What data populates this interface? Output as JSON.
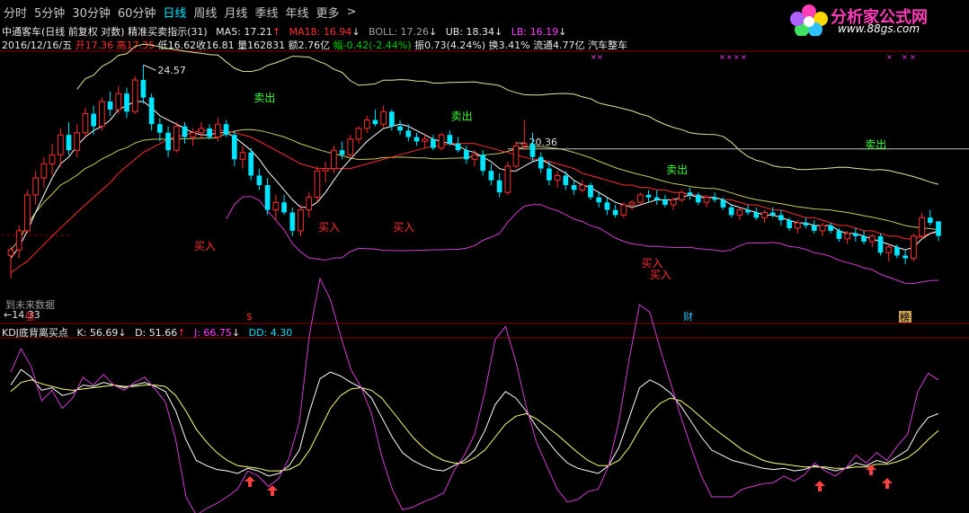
{
  "toolbar": {
    "periods": [
      "分时",
      "5分钟",
      "30分钟",
      "60分钟",
      "日线",
      "周线",
      "月线",
      "季线",
      "年线",
      "更多"
    ],
    "active": "日线",
    "chevron": ">"
  },
  "logo": {
    "name": "分析家公式网",
    "url": "www.88gs.com"
  },
  "header": {
    "stock": "中通客车(日线 前复权 对数)",
    "indicator": "精准买卖指示(31)",
    "ma5": "MA5: 17.21",
    "ma5_arrow": "↑",
    "ma18": "MA18: 16.94",
    "ma18_arrow": "↓",
    "boll": "BOLL: 17.26",
    "boll_arrow": "↓",
    "ub": "UB: 18.34",
    "ub_arrow": "↓",
    "lb": "LB: 16.19",
    "lb_arrow": "↓"
  },
  "quote": {
    "date": "2016/12/16/五",
    "open": "开17.36",
    "high": "高17.35",
    "low": "低16.62",
    "close": "收16.81",
    "volume": "量162831",
    "amount": "额2.76亿",
    "change": "幅-0.42(-2.44%)",
    "amplitude": "振0.73(4.24%)",
    "turnover": "换3.41%",
    "float": "流通4.77亿",
    "sector": "汽车整车"
  },
  "annotations": {
    "high_label": "24.57",
    "low_label": "14.33",
    "hline_label": "20.36",
    "hline_prefix": "— ",
    "sell": "卖出",
    "buy": "买入",
    "no_data": "到未来数据",
    "markers": [
      "张",
      "$",
      "财",
      "榜"
    ]
  },
  "kdj": {
    "name": "KDJ底背离买点",
    "k": "K: 56.69",
    "k_arrow": "↓",
    "d": "D: 51.66",
    "d_arrow": "↑",
    "j": "J: 66.75",
    "j_arrow": "↓",
    "dd": "DD: 4.30"
  },
  "colors": {
    "up": "#ff3030",
    "down": "#00e5ff",
    "ma5": "#ffffff",
    "ma18": "#ff3030",
    "boll": "#c8c864",
    "upper": "#e6e6a0",
    "lower": "#d040d0",
    "k": "#ffffff",
    "d": "#ffff80",
    "j": "#d040d0"
  },
  "chart_data": [
    {
      "type": "candlestick",
      "title": "中通客车(日线 前复权 对数)",
      "ylim": [
        14.0,
        25.2
      ],
      "candles": [
        [
          16.1,
          16.4,
          15.3,
          16.3
        ],
        [
          16.3,
          17.2,
          16.0,
          17.0
        ],
        [
          17.0,
          18.6,
          16.9,
          18.4
        ],
        [
          18.4,
          19.4,
          18.0,
          19.1
        ],
        [
          19.1,
          20.0,
          18.7,
          19.7
        ],
        [
          19.7,
          20.6,
          19.2,
          20.1
        ],
        [
          20.1,
          21.3,
          19.6,
          21.0
        ],
        [
          21.0,
          21.6,
          20.1,
          20.3
        ],
        [
          20.3,
          21.5,
          20.0,
          21.1
        ],
        [
          21.1,
          22.3,
          20.9,
          22.0
        ],
        [
          22.0,
          22.4,
          21.0,
          21.4
        ],
        [
          21.4,
          22.8,
          21.2,
          22.6
        ],
        [
          22.6,
          23.1,
          21.9,
          22.2
        ],
        [
          22.2,
          23.4,
          22.0,
          23.0
        ],
        [
          23.0,
          23.3,
          21.8,
          22.1
        ],
        [
          22.1,
          23.9,
          22.0,
          23.7
        ],
        [
          23.7,
          24.5,
          22.5,
          22.8
        ],
        [
          22.8,
          23.0,
          21.2,
          21.5
        ],
        [
          21.5,
          21.8,
          20.7,
          21.1
        ],
        [
          21.1,
          21.4,
          20.0,
          20.3
        ],
        [
          20.3,
          21.6,
          20.2,
          21.4
        ],
        [
          21.4,
          21.6,
          20.6,
          20.9
        ],
        [
          20.9,
          21.3,
          20.5,
          21.1
        ],
        [
          21.1,
          21.6,
          20.8,
          21.3
        ],
        [
          21.3,
          21.5,
          20.8,
          20.9
        ],
        [
          20.9,
          21.8,
          20.7,
          21.5
        ],
        [
          21.5,
          21.7,
          20.9,
          21.0
        ],
        [
          21.0,
          21.2,
          19.6,
          19.9
        ],
        [
          19.9,
          20.5,
          19.5,
          20.2
        ],
        [
          20.2,
          20.4,
          19.0,
          19.2
        ],
        [
          19.2,
          19.5,
          18.6,
          18.8
        ],
        [
          18.8,
          19.1,
          17.6,
          17.8
        ],
        [
          17.8,
          18.4,
          17.4,
          18.1
        ],
        [
          18.1,
          18.4,
          17.6,
          17.7
        ],
        [
          17.7,
          17.9,
          16.8,
          17.0
        ],
        [
          17.0,
          18.0,
          16.8,
          17.8
        ],
        [
          17.8,
          18.5,
          17.5,
          18.3
        ],
        [
          18.3,
          19.6,
          18.1,
          19.4
        ],
        [
          19.4,
          19.8,
          18.9,
          19.5
        ],
        [
          19.5,
          20.5,
          19.3,
          20.3
        ],
        [
          20.3,
          20.7,
          19.9,
          20.1
        ],
        [
          20.1,
          21.0,
          20.0,
          20.8
        ],
        [
          20.8,
          21.4,
          20.6,
          21.3
        ],
        [
          21.3,
          21.9,
          21.1,
          21.7
        ],
        [
          21.7,
          22.2,
          21.4,
          21.5
        ],
        [
          21.5,
          22.4,
          21.3,
          22.1
        ],
        [
          22.1,
          22.2,
          21.2,
          21.4
        ],
        [
          21.4,
          21.7,
          21.0,
          21.2
        ],
        [
          21.2,
          21.5,
          20.7,
          20.9
        ],
        [
          20.9,
          21.1,
          20.5,
          20.7
        ],
        [
          20.7,
          21.0,
          20.4,
          20.8
        ],
        [
          20.8,
          21.0,
          20.3,
          20.4
        ],
        [
          20.4,
          21.1,
          20.3,
          21.0
        ],
        [
          21.0,
          21.2,
          20.5,
          20.6
        ],
        [
          20.6,
          20.9,
          20.2,
          20.3
        ],
        [
          20.3,
          20.5,
          19.7,
          19.9
        ],
        [
          19.9,
          20.3,
          19.6,
          20.1
        ],
        [
          20.1,
          20.3,
          19.2,
          19.4
        ],
        [
          19.4,
          19.7,
          18.8,
          19.0
        ],
        [
          19.0,
          19.3,
          18.3,
          18.5
        ],
        [
          18.5,
          19.8,
          18.4,
          19.6
        ],
        [
          19.6,
          20.7,
          19.5,
          20.5
        ],
        [
          20.5,
          21.7,
          20.3,
          20.6
        ],
        [
          20.6,
          21.1,
          19.8,
          20.0
        ],
        [
          20.0,
          20.2,
          19.3,
          19.5
        ],
        [
          19.5,
          19.8,
          18.8,
          19.0
        ],
        [
          19.0,
          19.4,
          18.7,
          19.2
        ],
        [
          19.2,
          19.4,
          18.6,
          18.8
        ],
        [
          18.8,
          19.0,
          18.4,
          18.6
        ],
        [
          18.6,
          19.0,
          18.5,
          18.8
        ],
        [
          18.8,
          18.9,
          18.2,
          18.3
        ],
        [
          18.3,
          18.5,
          17.9,
          18.1
        ],
        [
          18.1,
          18.3,
          17.6,
          17.8
        ],
        [
          17.8,
          18.0,
          17.5,
          17.6
        ],
        [
          17.6,
          18.1,
          17.5,
          18.0
        ],
        [
          18.0,
          18.2,
          17.8,
          18.1
        ],
        [
          18.1,
          18.5,
          18.0,
          18.4
        ],
        [
          18.4,
          18.6,
          18.1,
          18.3
        ],
        [
          18.3,
          18.6,
          18.0,
          18.2
        ],
        [
          18.2,
          18.4,
          17.9,
          18.0
        ],
        [
          18.0,
          18.3,
          17.8,
          18.2
        ],
        [
          18.2,
          18.6,
          18.1,
          18.5
        ],
        [
          18.5,
          18.7,
          18.2,
          18.4
        ],
        [
          18.4,
          18.5,
          18.0,
          18.1
        ],
        [
          18.1,
          18.4,
          17.9,
          18.3
        ],
        [
          18.3,
          18.5,
          18.1,
          18.2
        ],
        [
          18.2,
          18.3,
          17.8,
          17.9
        ],
        [
          17.9,
          18.0,
          17.5,
          17.6
        ],
        [
          17.6,
          17.9,
          17.4,
          17.8
        ],
        [
          17.8,
          18.0,
          17.6,
          17.7
        ],
        [
          17.7,
          17.9,
          17.4,
          17.5
        ],
        [
          17.5,
          17.8,
          17.3,
          17.7
        ],
        [
          17.7,
          17.9,
          17.5,
          17.6
        ],
        [
          17.6,
          17.8,
          17.2,
          17.4
        ],
        [
          17.4,
          17.5,
          17.0,
          17.1
        ],
        [
          17.1,
          17.4,
          16.9,
          17.3
        ],
        [
          17.3,
          17.5,
          17.1,
          17.2
        ],
        [
          17.2,
          17.4,
          16.9,
          17.0
        ],
        [
          17.0,
          17.3,
          16.8,
          17.2
        ],
        [
          17.2,
          17.3,
          16.9,
          17.0
        ],
        [
          17.0,
          17.1,
          16.6,
          16.7
        ],
        [
          16.7,
          17.0,
          16.5,
          16.9
        ],
        [
          16.9,
          17.1,
          16.6,
          16.8
        ],
        [
          16.8,
          17.0,
          16.5,
          16.6
        ],
        [
          16.6,
          16.9,
          16.4,
          16.8
        ],
        [
          16.8,
          16.9,
          16.1,
          16.2
        ],
        [
          16.2,
          16.5,
          15.9,
          16.4
        ],
        [
          16.4,
          16.5,
          16.0,
          16.1
        ],
        [
          16.1,
          16.3,
          15.8,
          16.0
        ],
        [
          16.0,
          16.9,
          15.9,
          16.8
        ],
        [
          16.8,
          17.7,
          16.7,
          17.5
        ],
        [
          17.5,
          17.8,
          17.2,
          17.3
        ],
        [
          17.36,
          17.35,
          16.62,
          16.81
        ]
      ],
      "ma5": [
        16.0,
        16.4,
        17.0,
        17.7,
        18.4,
        19.1,
        19.7,
        20.0,
        20.5,
        20.9,
        21.2,
        21.4,
        21.7,
        22.2,
        22.4,
        22.6,
        22.6,
        22.3,
        21.9,
        21.7,
        21.5,
        21.3,
        21.1,
        21.0,
        21.0,
        21.1,
        21.1,
        20.9,
        20.6,
        20.3,
        19.9,
        19.4,
        19.0,
        18.6,
        18.2,
        17.9,
        17.9,
        18.1,
        18.5,
        19.0,
        19.5,
        19.9,
        20.3,
        20.7,
        21.0,
        21.3,
        21.4,
        21.5,
        21.4,
        21.2,
        21.0,
        20.8,
        20.7,
        20.6,
        20.5,
        20.3,
        20.2,
        20.0,
        19.8,
        19.5,
        19.4,
        19.4,
        19.6,
        19.8,
        19.9,
        19.7,
        19.5,
        19.3,
        19.0,
        18.8,
        18.7,
        18.5,
        18.3,
        18.1,
        18.0,
        17.9,
        18.0,
        18.1,
        18.2,
        18.2,
        18.2,
        18.3,
        18.4,
        18.3,
        18.3,
        18.3,
        18.2,
        18.0,
        17.9,
        17.8,
        17.7,
        17.6,
        17.6,
        17.5,
        17.4,
        17.3,
        17.3,
        17.2,
        17.2,
        17.2,
        17.0,
        16.9,
        16.9,
        16.8,
        16.7,
        16.6,
        16.5,
        16.4,
        16.3,
        16.4,
        16.7,
        16.9,
        17.0
      ],
      "ma18": [
        15.5,
        15.7,
        15.9,
        16.2,
        16.5,
        16.8,
        17.1,
        17.4,
        17.7,
        18.0,
        18.3,
        18.6,
        18.9,
        19.3,
        19.6,
        19.9,
        20.2,
        20.4,
        20.6,
        20.8,
        20.9,
        21.0,
        21.1,
        21.2,
        21.2,
        21.2,
        21.2,
        21.1,
        21.0,
        20.9,
        20.7,
        20.5,
        20.3,
        20.1,
        19.9,
        19.7,
        19.6,
        19.5,
        19.5,
        19.5,
        19.5,
        19.5,
        19.6,
        19.7,
        19.8,
        19.9,
        20.0,
        20.1,
        20.2,
        20.3,
        20.4,
        20.5,
        20.5,
        20.6,
        20.6,
        20.6,
        20.6,
        20.5,
        20.4,
        20.3,
        20.2,
        20.1,
        20.0,
        19.9,
        19.9,
        19.8,
        19.7,
        19.6,
        19.5,
        19.3,
        19.2,
        19.1,
        19.0,
        18.9,
        18.8,
        18.8,
        18.7,
        18.7,
        18.6,
        18.6,
        18.5,
        18.5,
        18.4,
        18.4,
        18.3,
        18.3,
        18.2,
        18.2,
        18.1,
        18.0,
        18.0,
        17.9,
        17.8,
        17.8,
        17.7,
        17.6,
        17.5,
        17.5,
        17.4,
        17.3,
        17.2,
        17.2,
        17.1,
        17.0,
        17.0,
        16.9,
        16.8,
        16.8,
        16.7,
        16.7,
        16.8,
        16.9,
        16.94
      ]
    },
    {
      "type": "line",
      "title": "KDJ底背离买点",
      "ylim": [
        -15,
        115
      ],
      "series": [
        {
          "name": "K",
          "values": [
            80,
            92,
            86,
            76,
            78,
            72,
            74,
            80,
            79,
            82,
            80,
            78,
            80,
            82,
            79,
            75,
            60,
            38,
            22,
            18,
            15,
            14,
            12,
            16,
            14,
            10,
            12,
            18,
            30,
            60,
            85,
            90,
            87,
            82,
            78,
            70,
            55,
            40,
            28,
            22,
            18,
            15,
            14,
            18,
            22,
            30,
            45,
            65,
            75,
            70,
            60,
            48,
            38,
            28,
            20,
            16,
            14,
            12,
            18,
            32,
            55,
            78,
            84,
            80,
            74,
            64,
            52,
            40,
            30,
            26,
            22,
            20,
            18,
            16,
            15,
            16,
            14,
            15,
            18,
            16,
            14,
            16,
            20,
            18,
            22,
            20,
            25,
            30,
            45,
            55,
            58
          ]
        },
        {
          "name": "D",
          "values": [
            75,
            82,
            84,
            81,
            79,
            77,
            76,
            77,
            78,
            79,
            80,
            79,
            79,
            80,
            80,
            79,
            72,
            60,
            46,
            36,
            28,
            22,
            18,
            17,
            16,
            14,
            14,
            15,
            19,
            30,
            46,
            62,
            72,
            77,
            78,
            76,
            70,
            60,
            50,
            40,
            32,
            26,
            22,
            20,
            20,
            24,
            30,
            40,
            50,
            56,
            58,
            54,
            48,
            42,
            35,
            28,
            22,
            18,
            18,
            22,
            32,
            46,
            58,
            66,
            70,
            68,
            62,
            55,
            48,
            42,
            36,
            30,
            26,
            22,
            20,
            19,
            18,
            17,
            17,
            17,
            16,
            16,
            17,
            17,
            19,
            19,
            21,
            24,
            30,
            38,
            45
          ]
        },
        {
          "name": "J",
          "values": [
            90,
            108,
            94,
            68,
            76,
            62,
            70,
            86,
            80,
            88,
            80,
            76,
            82,
            86,
            77,
            67,
            38,
            -6,
            -20,
            -15,
            -11,
            -6,
            0,
            14,
            10,
            2,
            8,
            24,
            52,
            120,
            162,
            146,
            118,
            92,
            78,
            58,
            25,
            0,
            -16,
            -14,
            -10,
            -7,
            -3,
            14,
            26,
            42,
            75,
            115,
            125,
            98,
            64,
            36,
            18,
            0,
            -10,
            -8,
            -2,
            0,
            18,
            52,
            100,
            142,
            136,
            108,
            82,
            56,
            32,
            10,
            -6,
            -6,
            -6,
            0,
            2,
            4,
            5,
            10,
            6,
            11,
            20,
            14,
            10,
            16,
            26,
            20,
            28,
            22,
            33,
            42,
            75,
            89,
            84
          ]
        }
      ]
    }
  ]
}
